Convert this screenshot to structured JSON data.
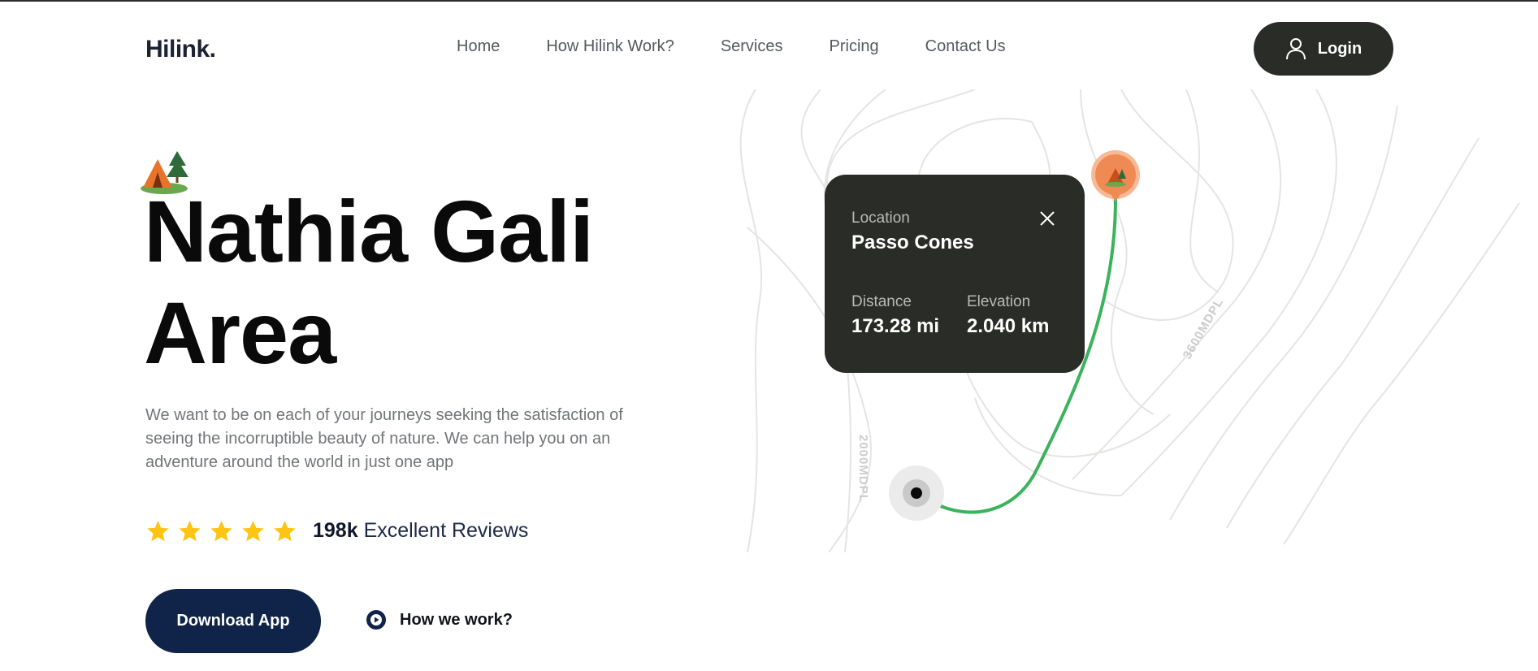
{
  "header": {
    "logo": "Hilink.",
    "nav": [
      "Home",
      "How Hilink Work?",
      "Services",
      "Pricing",
      "Contact Us"
    ],
    "login_label": "Login"
  },
  "hero": {
    "title_line1": "Nathia Gali",
    "title_line2": "Area",
    "description": "We want to be on each of your journeys seeking the satisfaction of seeing the incorruptible beauty of nature. We can help you on an adventure around the world in just one app",
    "rating_stars": 5,
    "reviews_count": "198k",
    "reviews_label": "Excellent Reviews",
    "download_label": "Download App",
    "how_label": "How we work?"
  },
  "map": {
    "contour_labels": [
      "2000MDPL",
      "3600MDPL"
    ],
    "route_color": "#3bb25c",
    "pin_color": "#f08a55"
  },
  "location_card": {
    "location_label": "Location",
    "location_value": "Passo Cones",
    "distance_label": "Distance",
    "distance_value": "173.28 mi",
    "elevation_label": "Elevation",
    "elevation_value": "2.040 km"
  },
  "colors": {
    "dark": "#292c27",
    "navy": "#0f2448",
    "star": "#fdc414"
  }
}
